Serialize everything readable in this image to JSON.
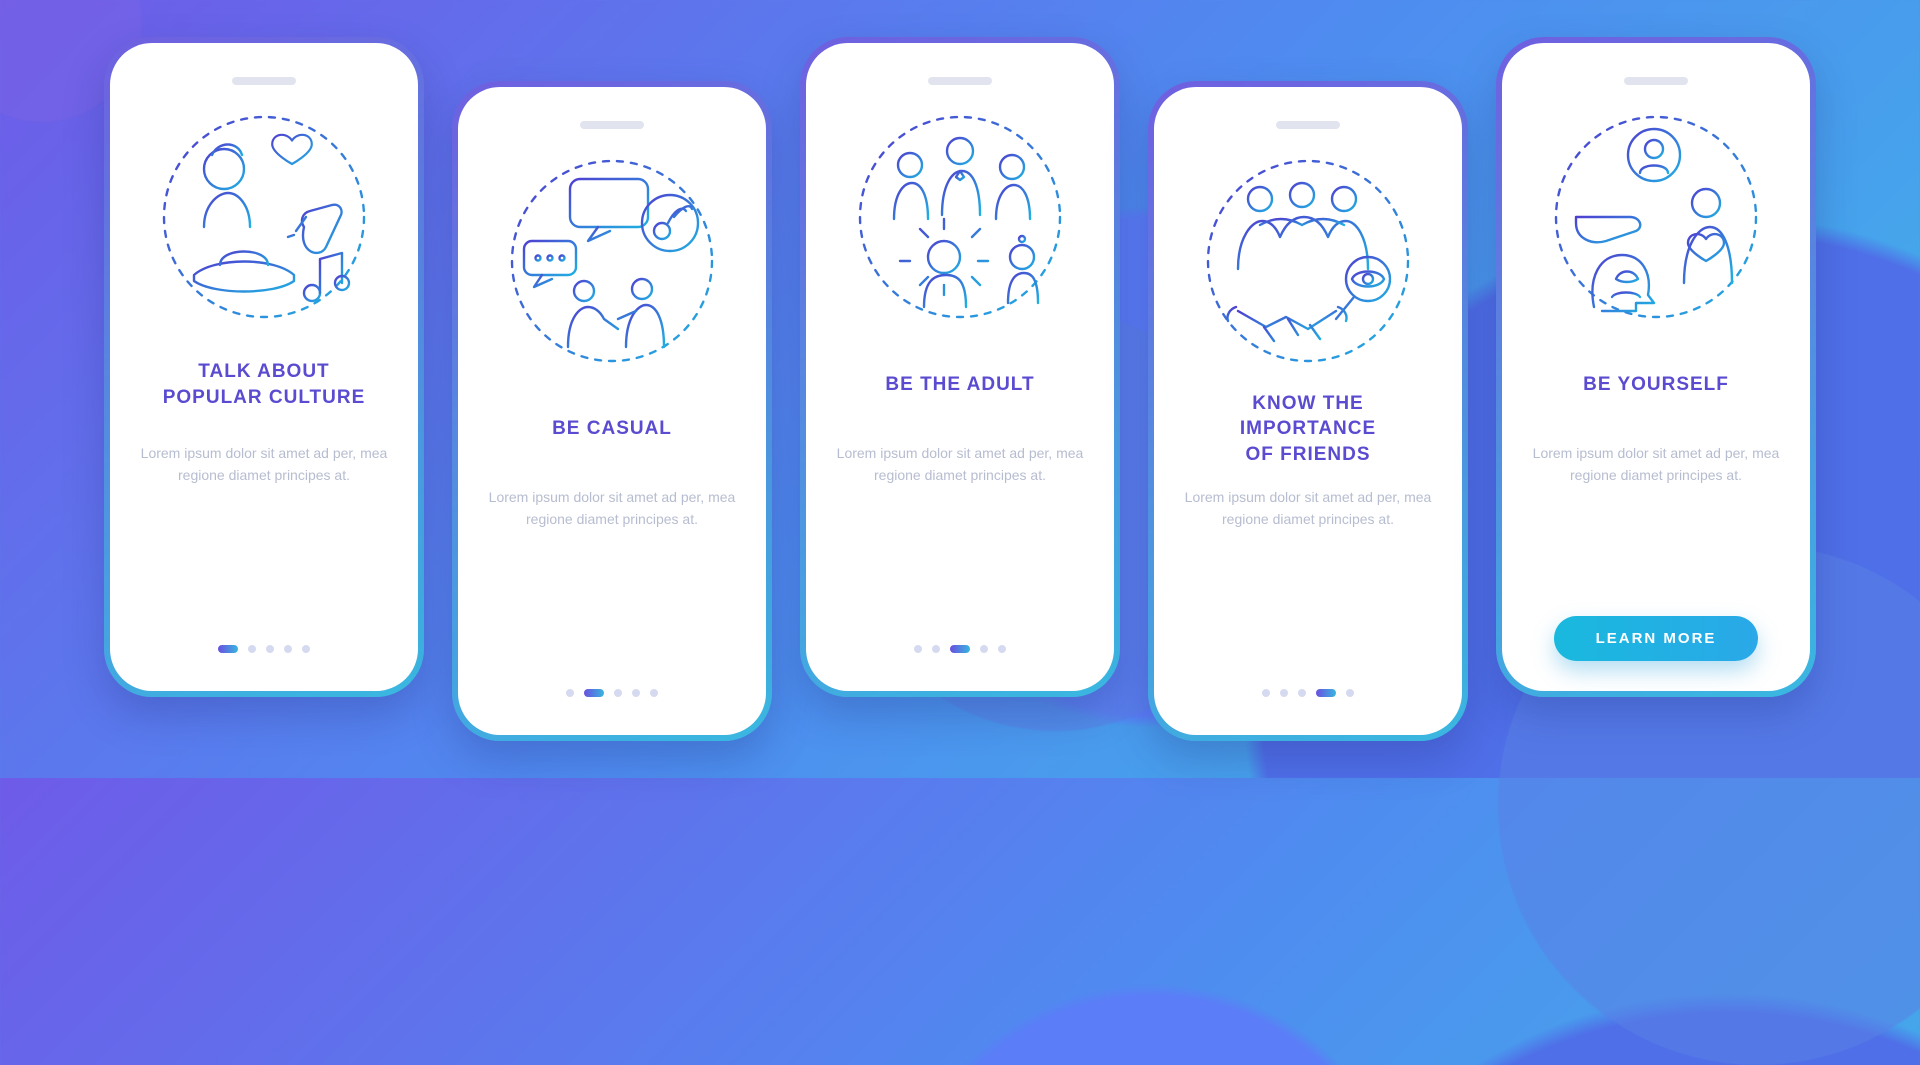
{
  "colors": {
    "grad_from": "#4f3fd0",
    "grad_to": "#1fb0e2",
    "title": "#5a4bd0",
    "muted": "#b7bdd0"
  },
  "lorem": "Lorem ipsum dolor sit amet ad per, mea regione diamet principes at.",
  "cta_label": "LEARN MORE",
  "screens": [
    {
      "title": "TALK ABOUT\nPOPULAR CULTURE",
      "active_index": 0,
      "icon": "pop-culture-icon",
      "has_cta": false
    },
    {
      "title": "BE CASUAL",
      "active_index": 1,
      "icon": "casual-chat-icon",
      "has_cta": false
    },
    {
      "title": "BE THE ADULT",
      "active_index": 2,
      "icon": "adult-guide-icon",
      "has_cta": false
    },
    {
      "title": "KNOW THE\nIMPORTANCE\nOF FRIENDS",
      "active_index": 3,
      "icon": "friends-icon",
      "has_cta": false
    },
    {
      "title": "BE YOURSELF",
      "active_index": 4,
      "icon": "be-yourself-icon",
      "has_cta": true
    }
  ],
  "dot_count": 5
}
